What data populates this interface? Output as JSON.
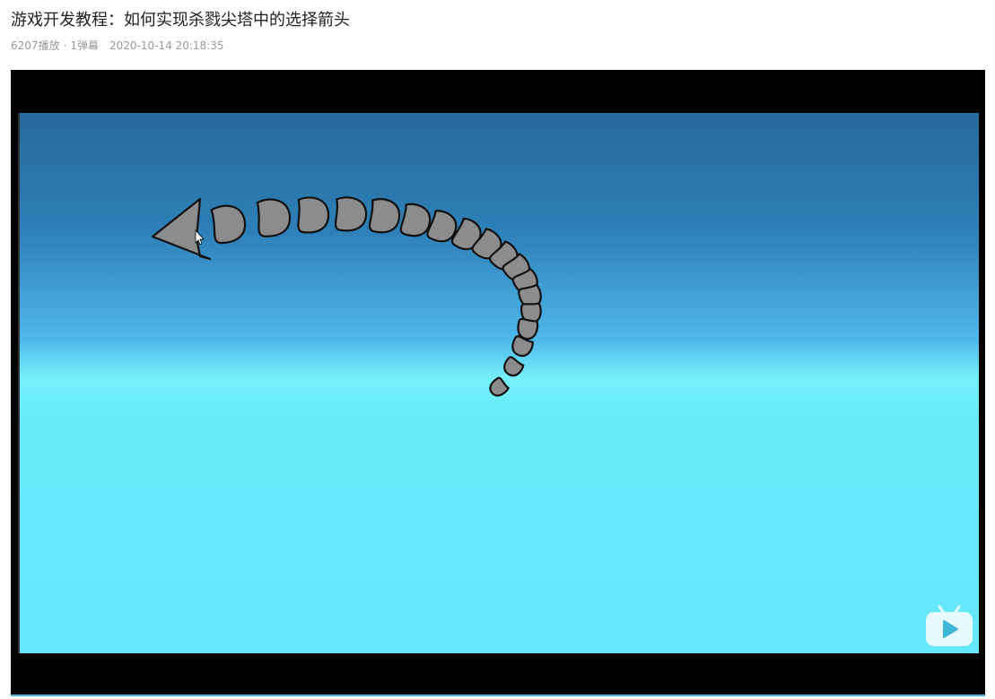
{
  "video": {
    "title": "游戏开发教程：如何实现杀戮尖塔中的选择箭头",
    "plays": "6207播放",
    "separator": "·",
    "danmaku": "1弹幕",
    "date": "2020-10-14 20:18:35"
  },
  "scene": {
    "sky_top": "#27699a",
    "sky_mid": "#4fb8ea",
    "horizon": "#74f0fb",
    "ground": "#66e8fb",
    "arrow_fill": "#8c8c8c",
    "arrow_stroke": "#111111"
  },
  "icons": {
    "cursor": "mouse-cursor-icon",
    "logo": "bilibili-tv-icon"
  }
}
